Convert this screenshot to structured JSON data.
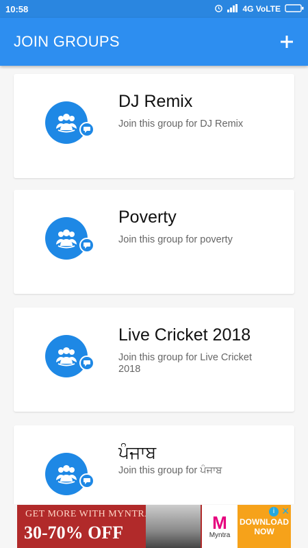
{
  "status_bar": {
    "time": "10:58",
    "network": "4G VoLTE"
  },
  "app_bar": {
    "title": "JOIN GROUPS"
  },
  "groups": [
    {
      "name": "DJ Remix",
      "description": "Join this group for DJ Remix"
    },
    {
      "name": "Poverty",
      "description": "Join this group for poverty"
    },
    {
      "name": "Live Cricket 2018",
      "description": "Join this group for Live Cricket 2018"
    },
    {
      "name": "ਪੰਜਾਬ",
      "description": "Join this group for ਪੰਜਾਬ"
    }
  ],
  "ad": {
    "headline": "GET MORE WITH MYNTRA",
    "offer": "30-70% OFF",
    "brand_letter": "M",
    "brand_name": "Myntra",
    "cta": "DOWNLOAD NOW"
  },
  "colors": {
    "primary": "#2d8ef0",
    "accent": "#1e88e5"
  }
}
